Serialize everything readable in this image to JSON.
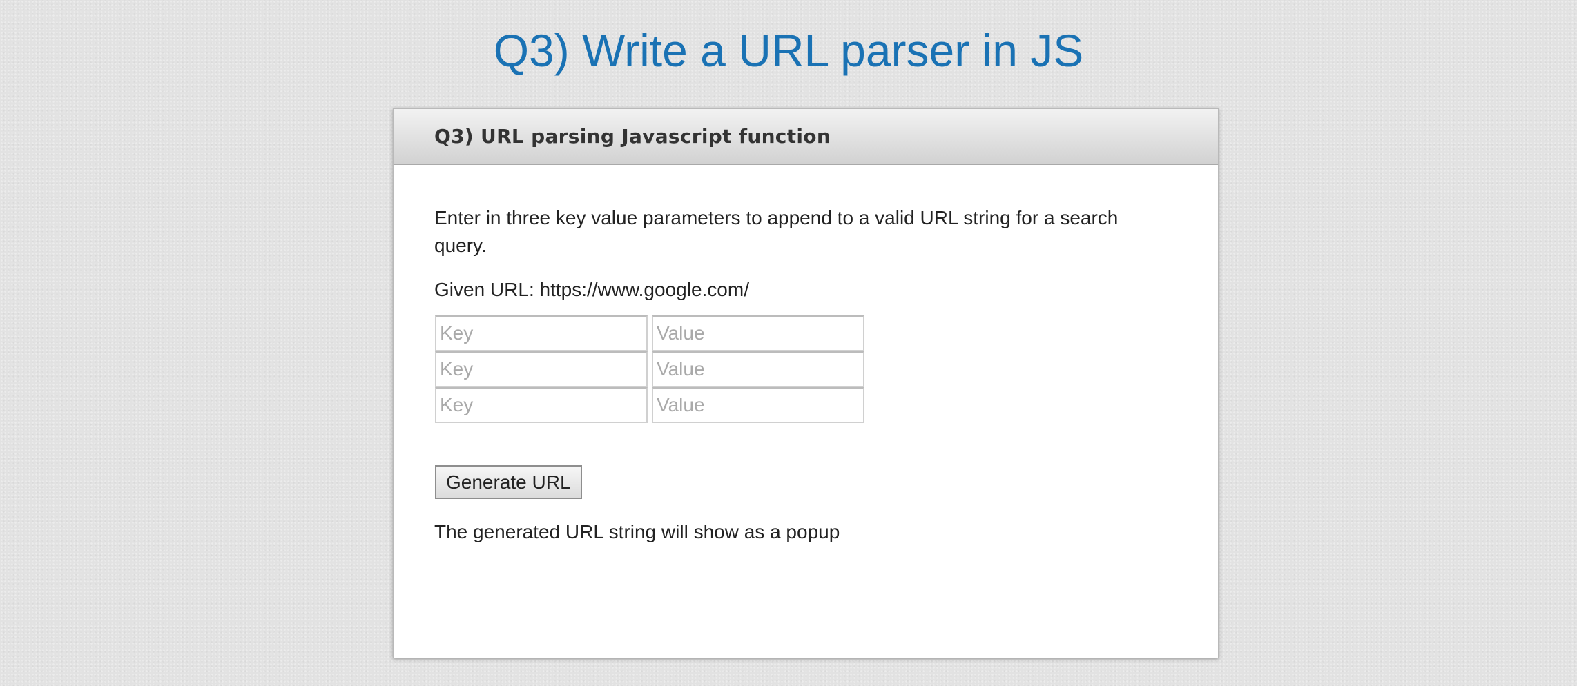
{
  "page": {
    "title": "Q3) Write a URL parser in JS"
  },
  "card": {
    "header_title": "Q3) URL parsing Javascript function",
    "instructions": "Enter in three key value parameters to append to a valid URL string for a search query.",
    "given_url": "Given URL: https://www.google.com/",
    "params": [
      {
        "key_placeholder": "Key",
        "value_placeholder": "Value",
        "key_value": "",
        "value_value": ""
      },
      {
        "key_placeholder": "Key",
        "value_placeholder": "Value",
        "key_value": "",
        "value_value": ""
      },
      {
        "key_placeholder": "Key",
        "value_placeholder": "Value",
        "key_value": "",
        "value_value": ""
      }
    ],
    "generate_button_label": "Generate URL",
    "result_note": "The generated URL string will show as a popup"
  },
  "colors": {
    "title": "#1a72b4",
    "background": "#e2e2e2",
    "card_background": "#ffffff",
    "text": "#222222"
  }
}
